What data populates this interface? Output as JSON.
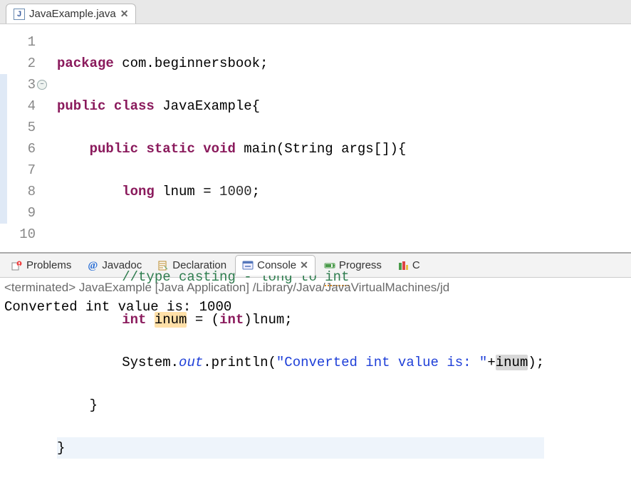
{
  "editor_tab": {
    "filename": "JavaExample.java"
  },
  "code": {
    "lines": {
      "1": {
        "package_kw": "package",
        "pkg": " com.beginnersbook;"
      },
      "2": {
        "pub": "public",
        "cls_kw": "class",
        "name": " JavaExample{"
      },
      "3": {
        "pub": "public",
        "stat": "static",
        "void_kw": "void",
        "sig": " main(String args[]){"
      },
      "4": {
        "type": "long",
        "rest": " lnum = ",
        "val": "1000",
        "semi": ";"
      },
      "5": "",
      "6": {
        "comment_a": "//type casting - long to ",
        "comment_b": "int"
      },
      "7": {
        "int1": "int",
        "sp1": " ",
        "hl": "inum",
        "eq": " = (",
        "int2": "int",
        "tail": ")lnum;"
      },
      "8": {
        "sys": "System.",
        "out": "out",
        "print": ".println(",
        "str": "\"Converted int value is: \"",
        "plus": "+",
        "hl": "inum",
        "close": ");"
      },
      "9": "    }",
      "10": "}"
    }
  },
  "line_numbers": [
    "1",
    "2",
    "3",
    "4",
    "5",
    "6",
    "7",
    "8",
    "9",
    "10"
  ],
  "bottom_tabs": {
    "problems": "Problems",
    "javadoc": "Javadoc",
    "declaration": "Declaration",
    "console": "Console",
    "progress": "Progress",
    "last": "C"
  },
  "console": {
    "status": "<terminated> JavaExample [Java Application] /Library/Java/JavaVirtualMachines/jd",
    "output": "Converted int value is: 1000"
  }
}
